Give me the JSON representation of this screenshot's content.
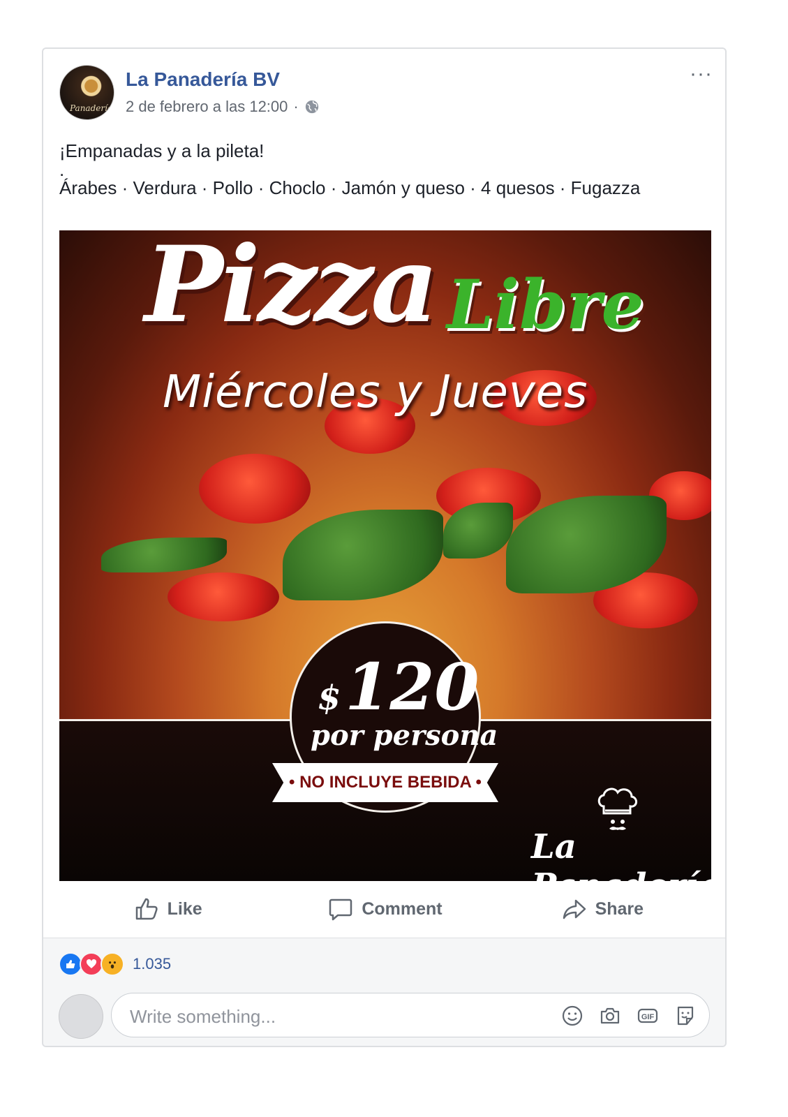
{
  "post": {
    "page_name": "La Panadería BV",
    "timestamp": "2 de febrero a las 12:00",
    "separator": "·",
    "more_label": "···",
    "text_line1": "¡Empanadas y a la pileta!",
    "text_line2": ".",
    "text_line3": "Árabes · Verdura · Pollo · Choclo · Jamón y queso · 4 quesos · Fugazza",
    "avatar_text": "Panadería"
  },
  "ad": {
    "title": "Pizza",
    "title_accent": "Libre",
    "days": "Miércoles y Jueves",
    "currency": "$",
    "price": "120",
    "per_person": "por persona",
    "notice": "• NO INCLUYE BEBIDA •",
    "brand": "La Panadería"
  },
  "actions": {
    "like": "Like",
    "comment": "Comment",
    "share": "Share"
  },
  "reactions": {
    "count": "1.035",
    "types": [
      "like-icon",
      "love-icon",
      "wow-icon"
    ]
  },
  "comment": {
    "placeholder": "Write something..."
  },
  "colors": {
    "link": "#365899",
    "accent_green": "#3bb32b",
    "like_blue": "#1877f2",
    "love_red": "#f33e58",
    "wow_yellow": "#f7b125"
  }
}
